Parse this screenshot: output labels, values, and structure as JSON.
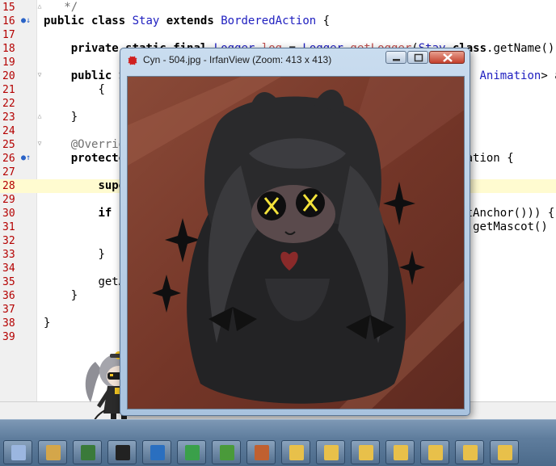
{
  "editor": {
    "lines": [
      {
        "num": "15",
        "text": "   */"
      },
      {
        "num": "16",
        "text": "public class Stay extends BorderedAction {"
      },
      {
        "num": "17",
        "text": ""
      },
      {
        "num": "18",
        "text": "    private static final Logger log = Logger.getLogger(Stay.class.getName());"
      },
      {
        "num": "19",
        "text": ""
      },
      {
        "num": "20",
        "text": "    public St                                                   Animation> ani"
      },
      {
        "num": "21",
        "text": "        {"
      },
      {
        "num": "22",
        "text": ""
      },
      {
        "num": "23",
        "text": "    }"
      },
      {
        "num": "24",
        "text": ""
      },
      {
        "num": "25",
        "text": "    @Override"
      },
      {
        "num": "26",
        "text": "    protected                                                 ation {"
      },
      {
        "num": "27",
        "text": ""
      },
      {
        "num": "28",
        "text": "        super.1"
      },
      {
        "num": "29",
        "text": ""
      },
      {
        "num": "30",
        "text": "        if ((g                                               etAnchor())) {"
      },
      {
        "num": "31",
        "text": "            log                                              { getMascot()"
      },
      {
        "num": "32",
        "text": "            thr"
      },
      {
        "num": "33",
        "text": "        }"
      },
      {
        "num": "34",
        "text": ""
      },
      {
        "num": "35",
        "text": "        getAni"
      },
      {
        "num": "36",
        "text": "    }"
      },
      {
        "num": "37",
        "text": ""
      },
      {
        "num": "38",
        "text": "}"
      },
      {
        "num": "39",
        "text": ""
      }
    ]
  },
  "image_viewer": {
    "title": "Cyn - 504.jpg - IrfanView (Zoom: 413 x 413)",
    "image_description_name": "dark-hooded-character-artwork"
  },
  "taskbar": {
    "items": [
      "calculator-icon",
      "paint-icon",
      "monitor-icon",
      "terminal-icon",
      "terminal-icon-2",
      "notes-icon",
      "network-icon",
      "apps-icon",
      "folder-icon",
      "folder-icon-2",
      "folder-icon-3",
      "folder-icon-4",
      "folder-icon-5",
      "folder-icon-6",
      "folder-icon-7"
    ]
  },
  "colors": {
    "keyword": "#000000",
    "type": "#2020c0",
    "field": "#c05050",
    "line_number": "#b40000",
    "highlight_line": "#fffbd0",
    "titlebar": "#c9dcef",
    "close_button": "#c4402c"
  }
}
